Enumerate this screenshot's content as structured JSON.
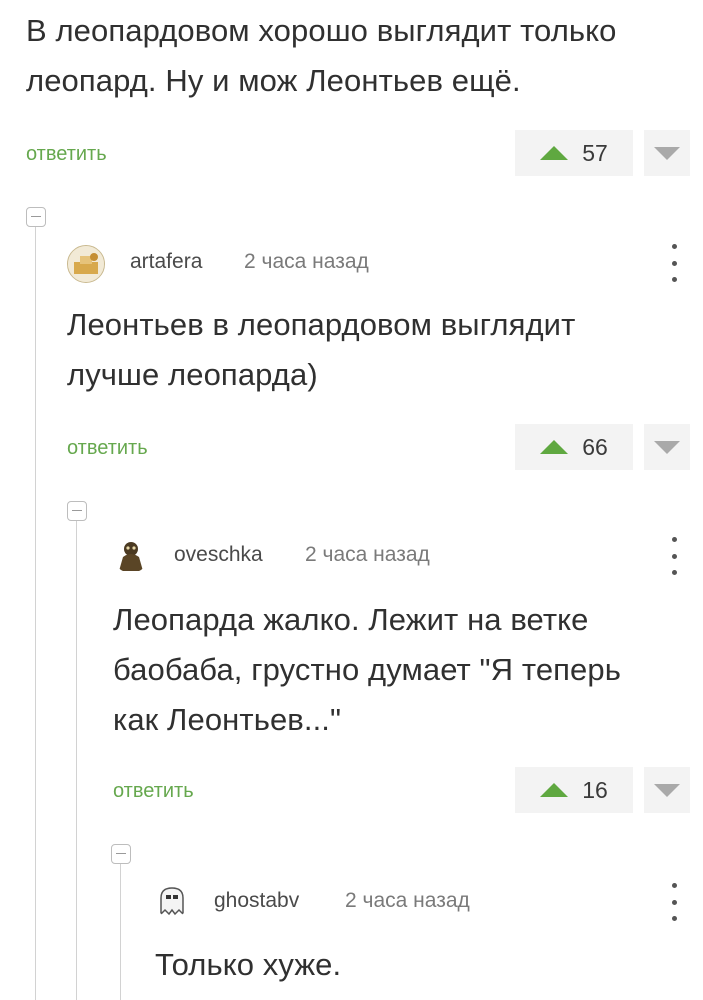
{
  "top_comment": {
    "text_line1": "В леопардовом хорошо выглядит только",
    "text_line2": "леопард. Ну и мож Леонтьев ещё.",
    "reply_label": "ответить",
    "votes": "57"
  },
  "reply1": {
    "username": "artafera",
    "time": "2 часа назад",
    "text_line1": "Леонтьев в леопардовом выглядит",
    "text_line2": "лучше леопарда)",
    "reply_label": "ответить",
    "votes": "66"
  },
  "reply2": {
    "username": "oveschka",
    "time": "2 часа назад",
    "text_line1": "Леопарда жалко. Лежит на ветке",
    "text_line2": "баобаба, грустно думает \"Я теперь",
    "text_line3": "как Леонтьев...\"",
    "reply_label": "ответить",
    "votes": "16"
  },
  "reply3": {
    "username": "ghostabv",
    "time": "2 часа назад",
    "text_line1": "Только хуже."
  },
  "colors": {
    "reply_link": "#66a84e",
    "upvote": "#5fa840",
    "downvote": "#a9a9a9",
    "vote_bg": "#f3f3f3"
  },
  "icons": {
    "upvote": "triangle-up-icon",
    "downvote": "triangle-down-icon",
    "more": "vertical-dots-icon",
    "collapse": "collapse-minus-icon"
  }
}
